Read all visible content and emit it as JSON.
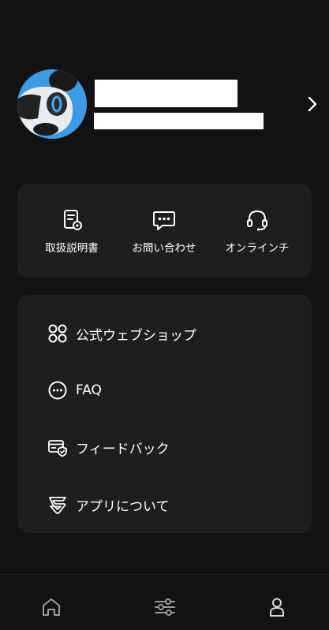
{
  "quick_actions": [
    {
      "label": "取扱説明書",
      "icon": "manual-icon"
    },
    {
      "label": "お問い合わせ",
      "icon": "chat-icon"
    },
    {
      "label": "オンラインチ",
      "icon": "headset-icon"
    }
  ],
  "menu": [
    {
      "label": "公式ウェブショップ",
      "icon": "shop-grid-icon"
    },
    {
      "label": "FAQ",
      "icon": "faq-icon"
    },
    {
      "label": "フィードバック",
      "icon": "feedback-icon"
    },
    {
      "label": "アプリについて",
      "icon": "app-logo-icon"
    }
  ],
  "bottom_nav": [
    {
      "icon": "home-icon"
    },
    {
      "icon": "settings-sliders-icon"
    },
    {
      "icon": "profile-icon"
    }
  ],
  "colors": {
    "background": "#121212",
    "card": "#1d1e20",
    "avatar_bg": "#3d9be6",
    "accent_blue": "#4aa8f0"
  }
}
